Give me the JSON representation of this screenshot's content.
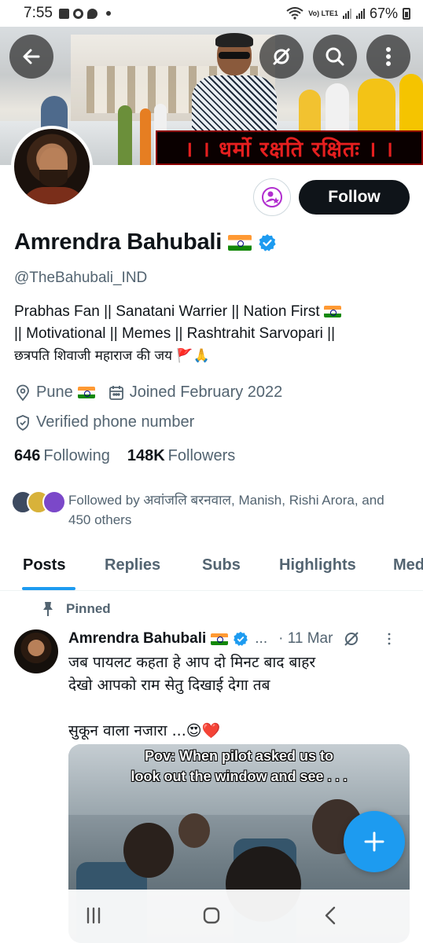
{
  "status_bar": {
    "time": "7:55",
    "battery": "67%",
    "network_label": "Vo) LTE1"
  },
  "banner": {
    "text": "। । धर्मो रक्षति रक्षितः । ।"
  },
  "profile": {
    "name": "Amrendra Bahubali",
    "handle": "@TheBahubali_IND",
    "bio_line1": "Prabhas Fan || Sanatani Warrier || Nation First",
    "bio_line2": "|| Motivational || Memes || Rashtrahit Sarvopari ||",
    "bio_line3": "छत्रपति शिवाजी महाराज की जय 🚩🙏",
    "location": "Pune",
    "joined": "Joined February 2022",
    "verified_phone": "Verified phone number",
    "following_count": "646",
    "following_label": "Following",
    "followers_count": "148K",
    "followers_label": "Followers",
    "followed_by": "Followed by अवांजलि बरनवाल, Manish, Rishi Arora, and 450 others",
    "follow_label": "Follow"
  },
  "tabs": [
    {
      "label": "Posts"
    },
    {
      "label": "Replies"
    },
    {
      "label": "Subs"
    },
    {
      "label": "Highlights"
    },
    {
      "label": "Med"
    }
  ],
  "pinned_tweet": {
    "pinned_label": "Pinned",
    "author": "Amrendra Bahubali",
    "ellipsis": "...",
    "date": "· 11 Mar",
    "line1": "जब पायलट कहता हे आप दो मिनट बाद बाहर",
    "line2": "देखो आपको राम सेतु दिखाई देगा तब",
    "line3": "सुकून वाला नजारा ...😍❤️",
    "media_caption_1": "Pov: When pilot asked us to",
    "media_caption_2": "look out the window and see . . ."
  },
  "colors": {
    "accent": "#1d9bf0",
    "text": "#0f1419",
    "secondary": "#536471",
    "follow_bg": "#0f1419",
    "banner_text": "#e41f1f"
  },
  "icons": {
    "back": "back-arrow-icon",
    "grok": "grok-icon",
    "search": "search-icon",
    "more": "more-vert-icon",
    "subscribe": "subscribe-star-person-icon",
    "verified": "verified-badge-icon",
    "location": "location-pin-icon",
    "calendar": "calendar-icon",
    "shield": "shield-check-icon",
    "pin": "pin-icon",
    "compose": "plus-icon"
  }
}
